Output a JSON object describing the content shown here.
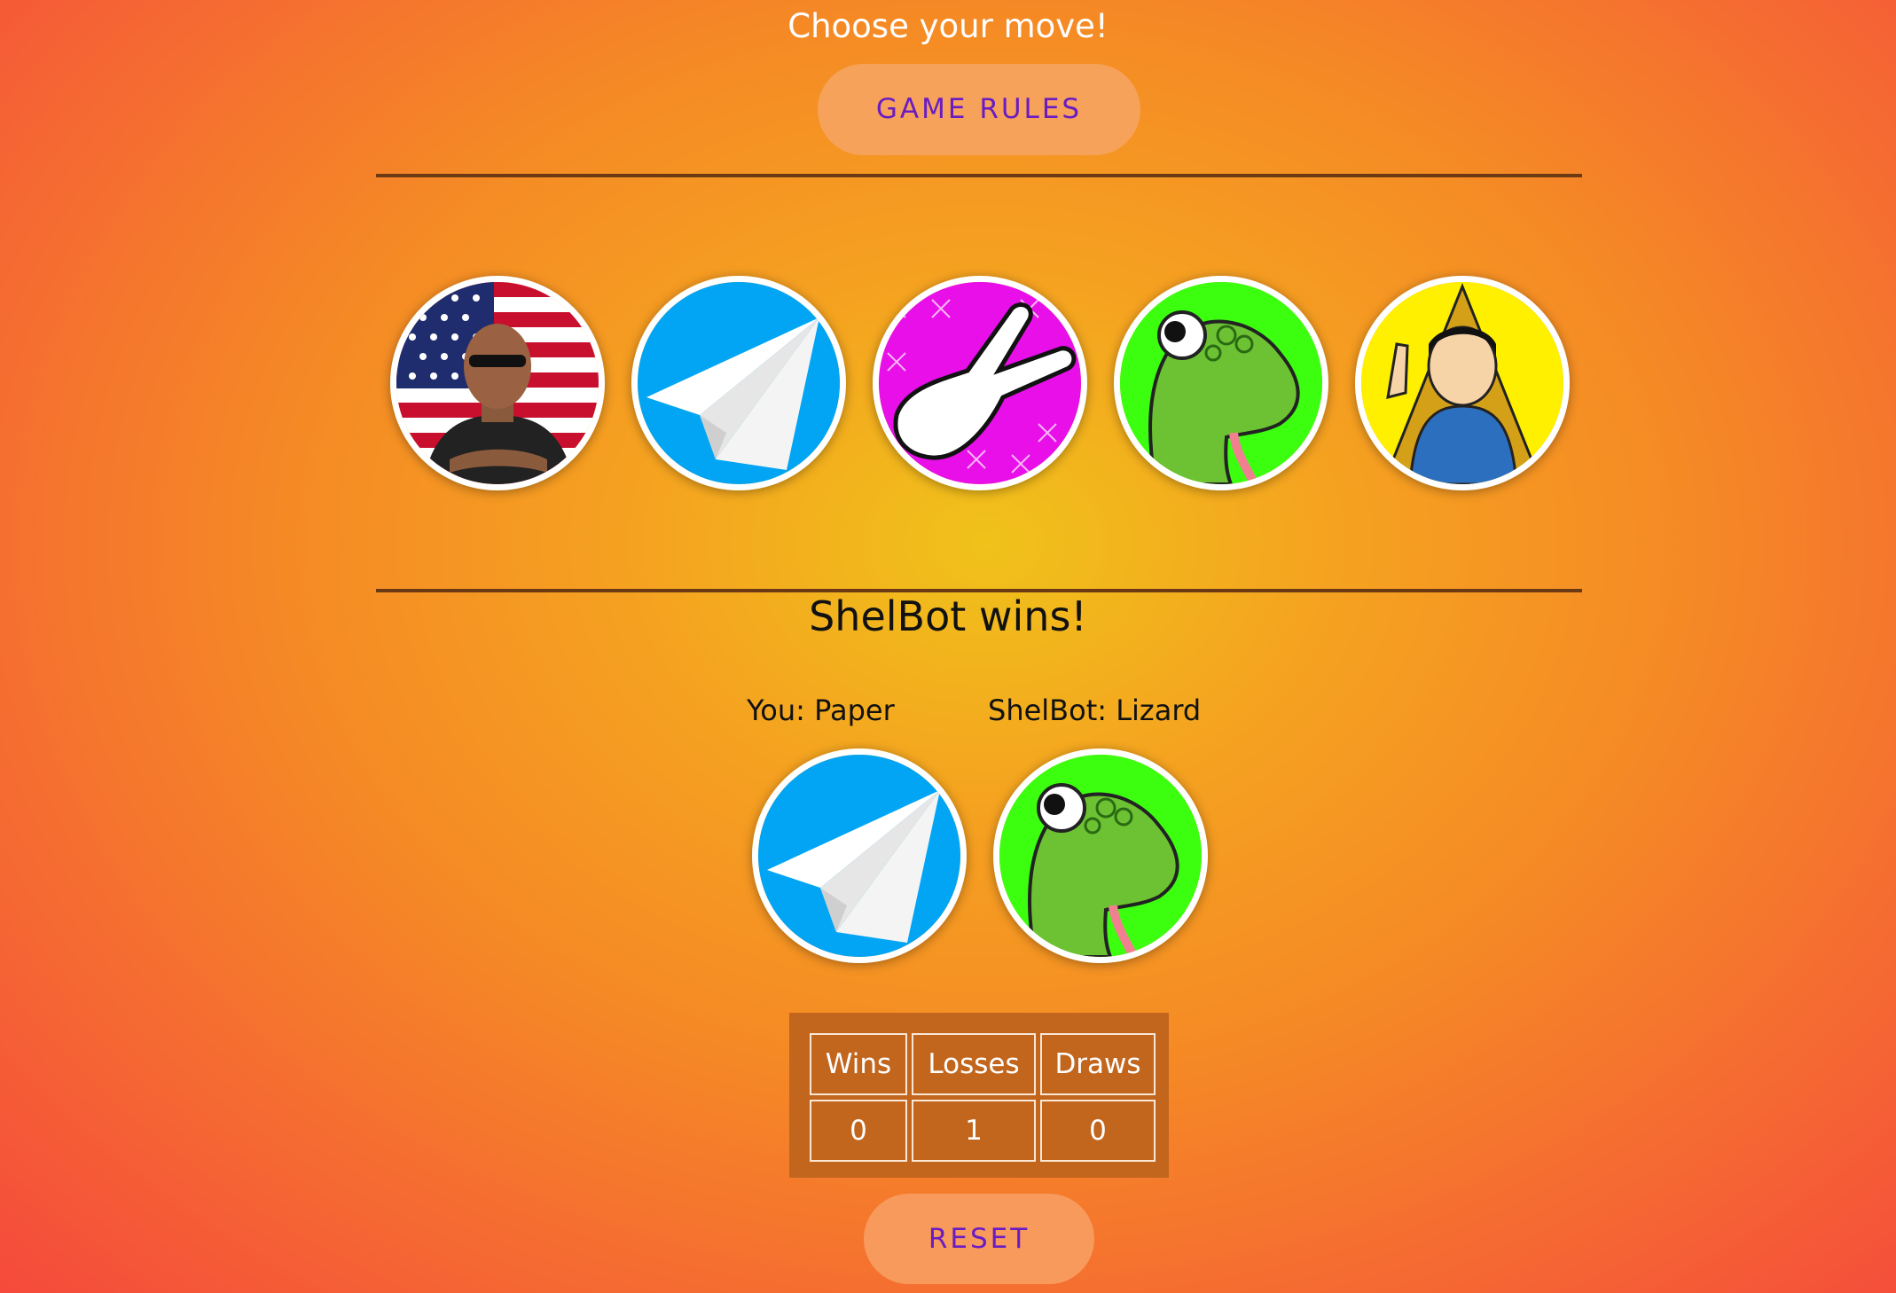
{
  "header": {
    "title": "Choose your move!",
    "rules_label": "GAME RULES"
  },
  "moves": [
    {
      "name": "rock",
      "icon": "rock-portrait-icon"
    },
    {
      "name": "paper",
      "icon": "paper-plane-icon"
    },
    {
      "name": "scissors",
      "icon": "scissors-hand-icon"
    },
    {
      "name": "lizard",
      "icon": "lizard-icon"
    },
    {
      "name": "spock",
      "icon": "spock-icon"
    }
  ],
  "result": {
    "message": "ShelBot wins!",
    "player_label": "You: Paper",
    "bot_label": "ShelBot: Lizard"
  },
  "scoreboard": {
    "headers": [
      "Wins",
      "Losses",
      "Draws"
    ],
    "values": [
      "0",
      "1",
      "0"
    ]
  },
  "reset_label": "RESET",
  "colors": {
    "accent": "#6a1cc2",
    "button": "#f6a25a",
    "divider": "#6b3a14",
    "table_bg": "#c2661e"
  }
}
